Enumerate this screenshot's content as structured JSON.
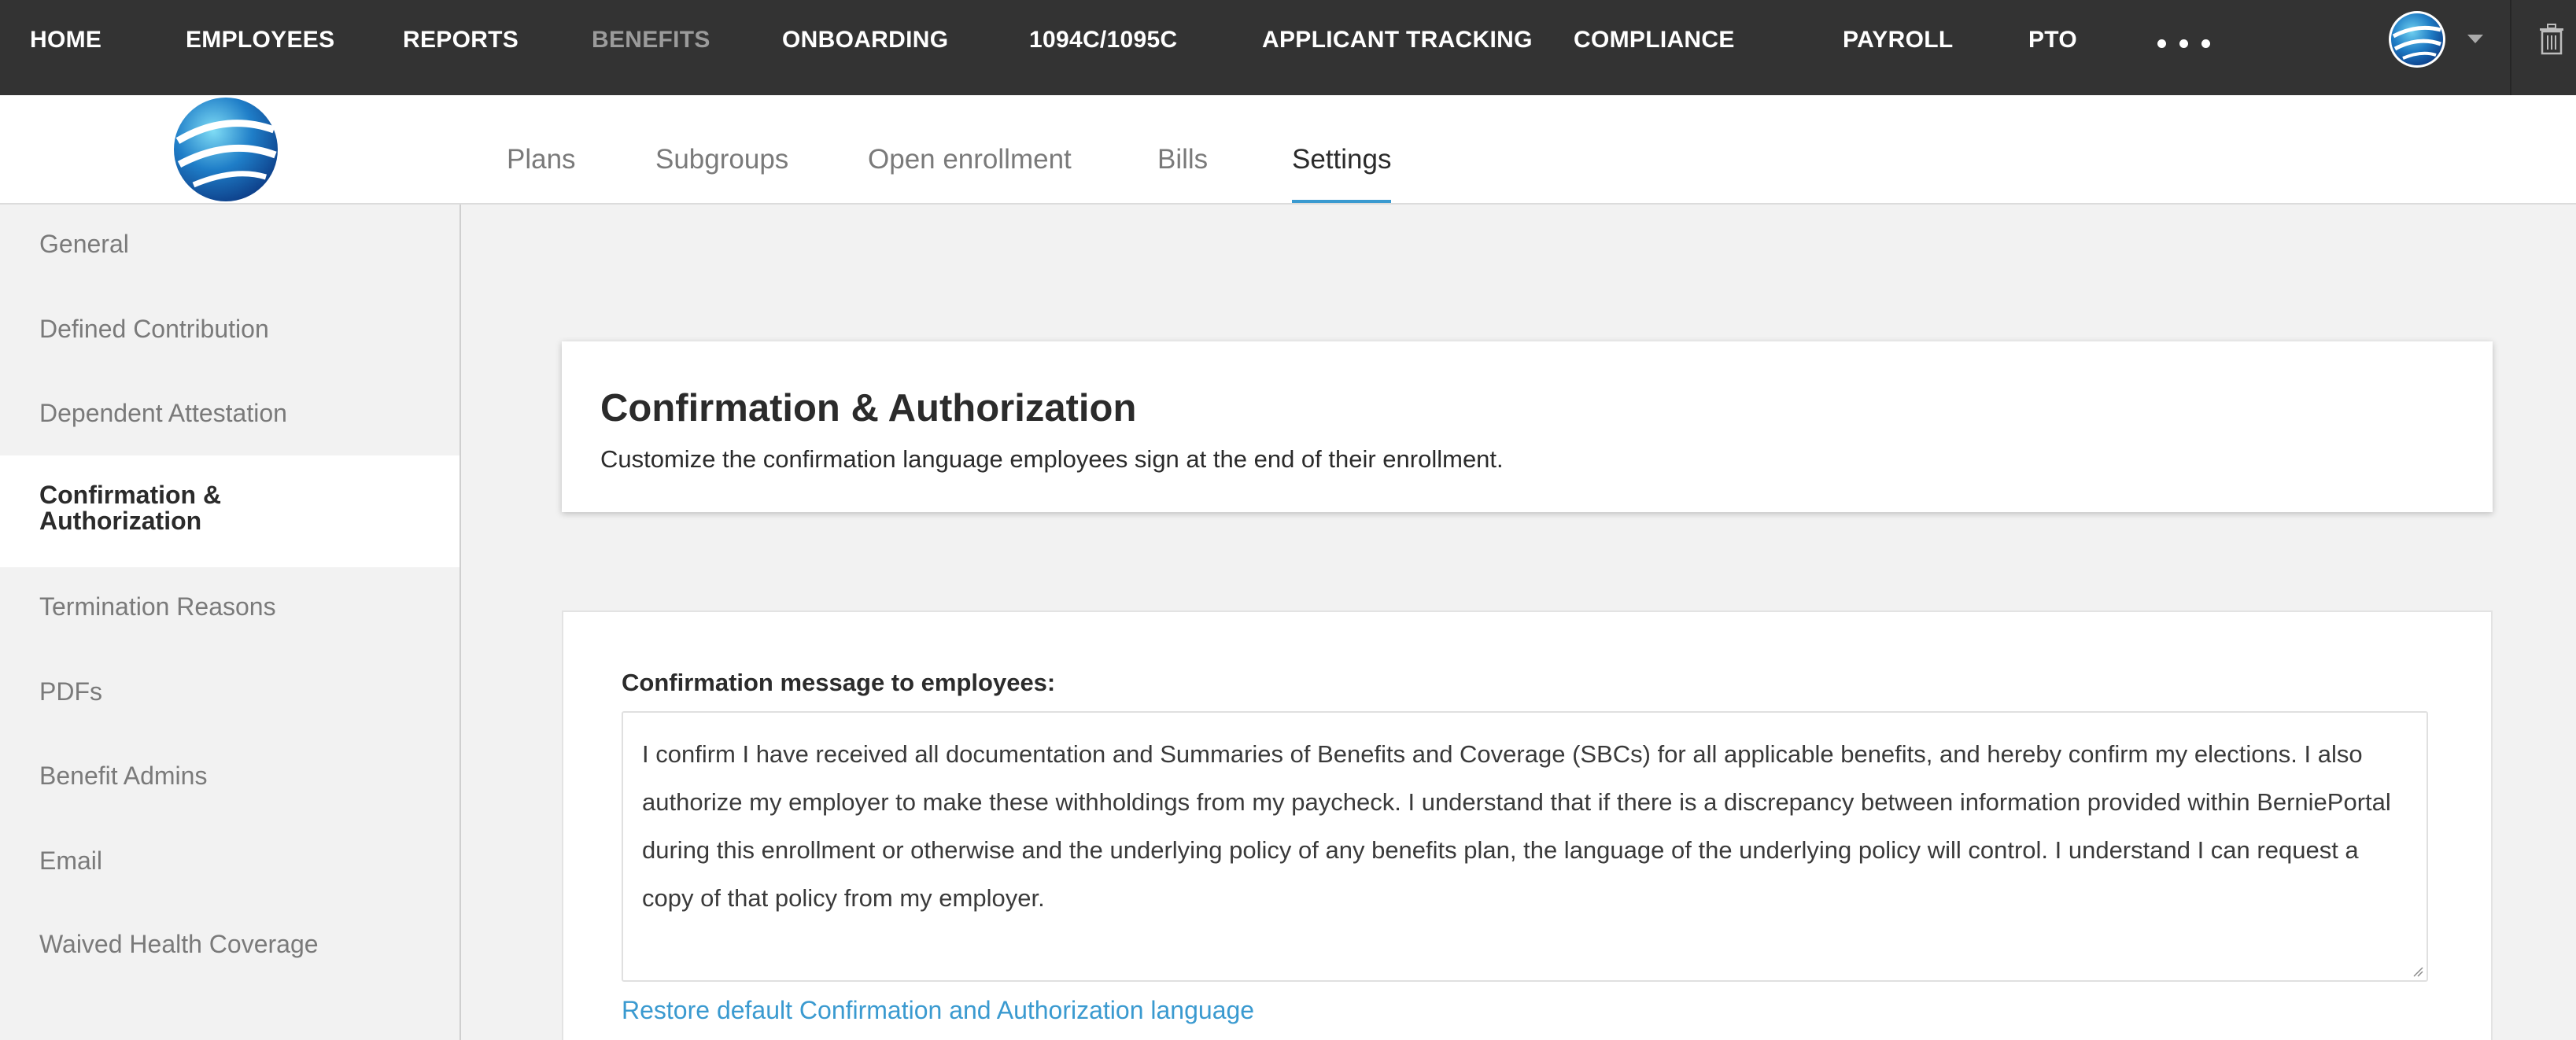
{
  "topnav": {
    "items": [
      "HOME",
      "EMPLOYEES",
      "REPORTS",
      "BENEFITS",
      "ONBOARDING",
      "1094C/1095C",
      "APPLICANT TRACKING",
      "COMPLIANCE",
      "PAYROLL",
      "PTO"
    ],
    "active": "BENEFITS",
    "more_icon": "more-dots-icon",
    "avatar_icon": "globe-avatar-icon",
    "menu_icon": "caret-down-icon",
    "trash_icon": "trash-icon"
  },
  "subnav": {
    "logo_icon": "globe-logo-icon",
    "tabs": [
      "Plans",
      "Subgroups",
      "Open enrollment",
      "Bills",
      "Settings"
    ],
    "active_tab": "Settings"
  },
  "sidebar": {
    "items": [
      "General",
      "Defined Contribution",
      "Dependent Attestation",
      "Confirmation & Authorization",
      "Termination Reasons",
      "PDFs",
      "Benefit Admins",
      "Email",
      "Waived Health Coverage"
    ],
    "active_line1": "Confirmation &",
    "active_line2": "Authorization"
  },
  "header_card": {
    "title": "Confirmation & Authorization",
    "subtitle": "Customize the confirmation language employees sign at the end of their enrollment."
  },
  "form": {
    "label": "Confirmation message to employees:",
    "message": "I confirm I have received all documentation and Summaries of Benefits and Coverage (SBCs) for all applicable benefits, and hereby confirm my elections. I also authorize my employer to make these withholdings from my paycheck. I understand that if there is a discrepancy between information provided within BerniePortal during this enrollment or otherwise and the underlying policy of any benefits plan, the language of the underlying policy will control. I understand I can request a copy of that policy from my employer.",
    "restore_link": "Restore default Confirmation and Authorization language"
  },
  "colors": {
    "topnav_bg": "#333333",
    "accent": "#3a9ad0",
    "page_bg": "#f2f2f2",
    "muted_text": "#7a7a7a"
  }
}
